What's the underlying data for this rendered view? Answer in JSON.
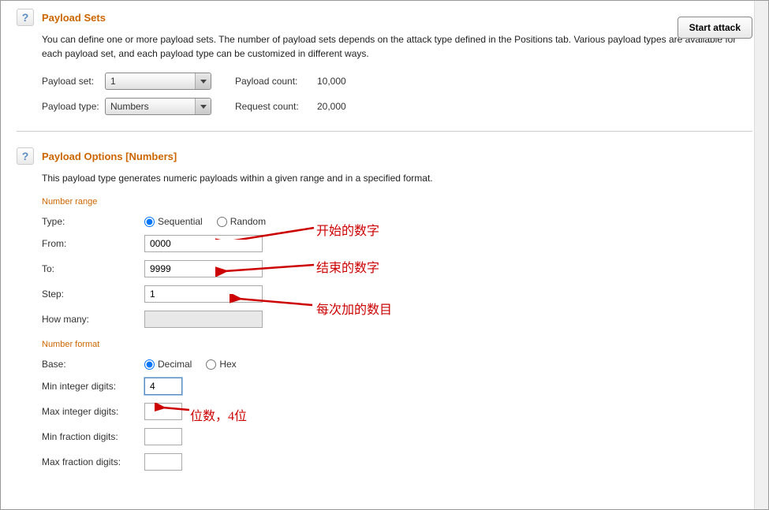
{
  "colors": {
    "accent": "#cc6600",
    "annotation": "#cc0000"
  },
  "startAttack": "Start attack",
  "payloadSets": {
    "title": "Payload Sets",
    "desc": "You can define one or more payload sets. The number of payload sets depends on the attack type defined in the Positions tab. Various payload types are available for each payload set, and each payload type can be customized in different ways.",
    "payloadSetLabel": "Payload set:",
    "payloadSetValue": "1",
    "payloadTypeLabel": "Payload type:",
    "payloadTypeValue": "Numbers",
    "payloadCountLabel": "Payload count:",
    "payloadCountValue": "10,000",
    "requestCountLabel": "Request count:",
    "requestCountValue": "20,000"
  },
  "payloadOptions": {
    "title": "Payload Options [Numbers]",
    "desc": "This payload type generates numeric payloads within a given range and in a specified format.",
    "numberRange": {
      "title": "Number range",
      "typeLabel": "Type:",
      "sequential": "Sequential",
      "random": "Random",
      "fromLabel": "From:",
      "fromValue": "0000",
      "toLabel": "To:",
      "toValue": "9999",
      "stepLabel": "Step:",
      "stepValue": "1",
      "howManyLabel": "How many:"
    },
    "numberFormat": {
      "title": "Number format",
      "baseLabel": "Base:",
      "decimal": "Decimal",
      "hex": "Hex",
      "minIntLabel": "Min integer digits:",
      "minIntValue": "4",
      "maxIntLabel": "Max integer digits:",
      "minFracLabel": "Min fraction digits:",
      "maxFracLabel": "Max fraction digits:"
    }
  },
  "annotations": {
    "from": "开始的数字",
    "to": "结束的数字",
    "step": "每次加的数目",
    "minInt": "位数，4位"
  }
}
